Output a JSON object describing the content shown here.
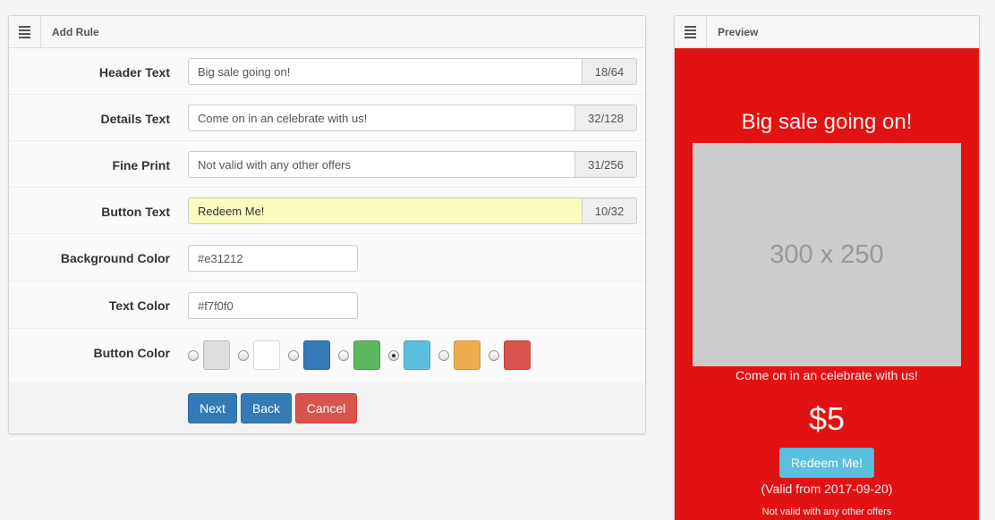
{
  "add_rule": {
    "title": "Add Rule",
    "fields": {
      "header_text": {
        "label": "Header Text",
        "value": "Big sale going on!",
        "counter": "18/64"
      },
      "details_text": {
        "label": "Details Text",
        "value": "Come on in an celebrate with us!",
        "counter": "32/128"
      },
      "fine_print": {
        "label": "Fine Print",
        "value": "Not valid with any other offers",
        "counter": "31/256"
      },
      "button_text": {
        "label": "Button Text",
        "value": "Redeem Me!",
        "counter": "10/32"
      },
      "background_color": {
        "label": "Background Color",
        "value": "#e31212"
      },
      "text_color": {
        "label": "Text Color",
        "value": "#f7f0f0"
      },
      "button_color": {
        "label": "Button Color",
        "options": [
          "#dddddd",
          "#ffffff",
          "#337ab7",
          "#5cb85c",
          "#5bc0de",
          "#f0ad4e",
          "#d9534f"
        ],
        "selected_index": 4
      }
    },
    "buttons": {
      "next": "Next",
      "back": "Back",
      "cancel": "Cancel"
    }
  },
  "preview": {
    "title": "Preview",
    "header": "Big sale going on!",
    "image_placeholder": "300 x 250",
    "details": "Come on in an celebrate with us!",
    "price": "$5",
    "button": "Redeem Me!",
    "valid": "(Valid from 2017-09-20)",
    "fine_print": "Not valid with any other offers"
  },
  "colors": {
    "preview_background": "#e31212",
    "preview_text": "#f7f0f0",
    "primary": "#337ab7",
    "danger": "#d9534f",
    "info": "#5bc0de"
  },
  "icons": {
    "panel_menu": "hamburger-icon"
  }
}
